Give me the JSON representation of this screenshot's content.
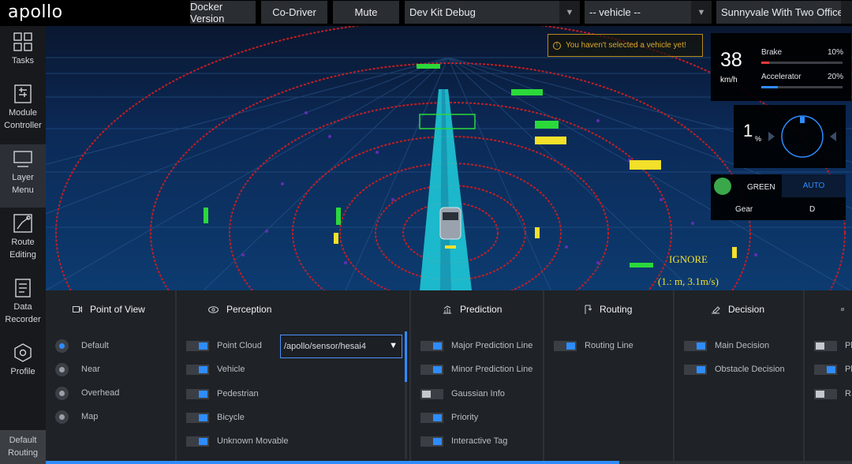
{
  "app": {
    "logo": "apollo"
  },
  "topbar": {
    "docker_version": "Docker Version",
    "co_driver": "Co-Driver",
    "mute": "Mute",
    "mode_select": "Dev Kit Debug",
    "vehicle_select": "-- vehicle --",
    "map_select": "Sunnyvale With Two Offices"
  },
  "sidebar": {
    "items": [
      {
        "label": "Tasks",
        "icon": "grid-icon"
      },
      {
        "label": "Module Controller",
        "icon": "sliders-icon"
      },
      {
        "label": "Layer Menu",
        "icon": "monitor-icon",
        "active": true
      },
      {
        "label": "Route Editing",
        "icon": "route-icon"
      },
      {
        "label": "Data Recorder",
        "icon": "document-icon"
      },
      {
        "label": "Profile",
        "icon": "hexagon-icon"
      }
    ],
    "footer": "Default Routing"
  },
  "scene": {
    "warning": "You haven't selected a vehicle yet!",
    "overlay_text": [
      "IGNORE",
      "(1.: m, 3.1m/s)"
    ],
    "speed": "38",
    "speed_unit": "km/h",
    "brake_label": "Brake",
    "brake_pct": "10%",
    "brake_value": 0.1,
    "accel_label": "Accelerator",
    "accel_pct": "20%",
    "accel_value": 0.2,
    "steering_value": "1",
    "steering_unit": "%",
    "signal_label": "GREEN",
    "drive_mode": "AUTO",
    "gear_label": "Gear",
    "gear_value": "D",
    "colors": {
      "brake": "#e23b3b",
      "accel": "#2f8cff",
      "signal": "#3aa84a"
    }
  },
  "panel": {
    "point_of_view": {
      "title": "Point of View",
      "icon": "camera-icon",
      "options": [
        {
          "label": "Default",
          "selected": true
        },
        {
          "label": "Near",
          "selected": false
        },
        {
          "label": "Overhead",
          "selected": false
        },
        {
          "label": "Map",
          "selected": false
        }
      ]
    },
    "perception": {
      "title": "Perception",
      "icon": "eye-icon",
      "pointcloud_channel": "/apollo/sensor/hesai4",
      "items": [
        {
          "label": "Point Cloud",
          "on": true
        },
        {
          "label": "Vehicle",
          "on": true
        },
        {
          "label": "Pedestrian",
          "on": true
        },
        {
          "label": "Bicycle",
          "on": true
        },
        {
          "label": "Unknown Movable",
          "on": true
        }
      ]
    },
    "prediction": {
      "title": "Prediction",
      "icon": "chart-icon",
      "items": [
        {
          "label": "Major Prediction Line",
          "on": true
        },
        {
          "label": "Minor Prediction Line",
          "on": true
        },
        {
          "label": "Gaussian Info",
          "on": false
        },
        {
          "label": "Priority",
          "on": true
        },
        {
          "label": "Interactive Tag",
          "on": true
        }
      ]
    },
    "routing": {
      "title": "Routing",
      "icon": "routing-icon",
      "items": [
        {
          "label": "Routing Line",
          "on": true
        }
      ]
    },
    "decision": {
      "title": "Decision",
      "icon": "decision-icon",
      "items": [
        {
          "label": "Main Decision",
          "on": true
        },
        {
          "label": "Obstacle Decision",
          "on": true
        }
      ]
    },
    "planning": {
      "items": [
        {
          "label": "Pl",
          "on": false
        },
        {
          "label": "Pl",
          "on": true
        },
        {
          "label": "RS",
          "on": false
        }
      ]
    }
  }
}
